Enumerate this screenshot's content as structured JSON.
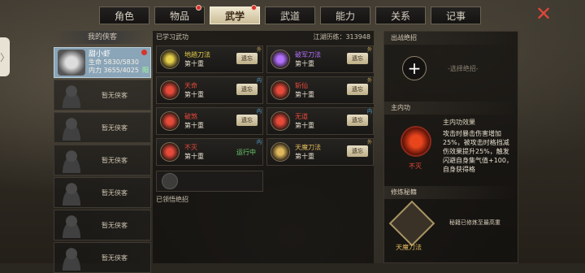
{
  "tabs": [
    {
      "label": "角色",
      "dot": false
    },
    {
      "label": "物品",
      "dot": true
    },
    {
      "label": "武学",
      "dot": true,
      "active": true
    },
    {
      "label": "武道",
      "dot": false
    },
    {
      "label": "能力",
      "dot": false
    },
    {
      "label": "关系",
      "dot": false
    },
    {
      "label": "记事",
      "dot": false
    }
  ],
  "left": {
    "title": "我的侠客",
    "hero": {
      "name": "甜小虾",
      "hp": "生命 5830/5830",
      "mp": "内力 3655/4025",
      "yang": "阳"
    },
    "empty_label": "暂无侠客"
  },
  "mid": {
    "learned_label": "已学习武功",
    "exp_label": "江湖历练：313948",
    "skills": [
      {
        "name": "地趟刀法",
        "level": "第十重",
        "button": "遗忘",
        "tag": "外",
        "color": "#e6d04a"
      },
      {
        "name": "破军刀法",
        "level": "第十重",
        "button": "遗忘",
        "tag": "外",
        "color": "#b470ff"
      },
      {
        "name": "天命",
        "level": "第十重",
        "button": "遗忘",
        "tag": "内",
        "color": "#e84a3a"
      },
      {
        "name": "斩仙",
        "level": "第十重",
        "button": "遗忘",
        "tag": "外",
        "color": "#e84a3a"
      },
      {
        "name": "破煞",
        "level": "第十重",
        "button": "遗忘",
        "tag": "内",
        "color": "#e84a3a"
      },
      {
        "name": "无道",
        "level": "第十重",
        "button": "遗忘",
        "tag": "内",
        "color": "#e84a3a"
      },
      {
        "name": "不灭",
        "level": "第十重",
        "status": "运行中",
        "tag": "内",
        "color": "#e84a3a"
      },
      {
        "name": "天魔刀法",
        "level": "第十重",
        "button": "遗忘",
        "tag": "外",
        "color": "#e0b85c"
      }
    ],
    "comprehended_label": "已领悟绝招"
  },
  "right": {
    "burst_label": "出战绝招",
    "choose_label": "-选择绝招-",
    "inner_label": "主内功",
    "inner_effect_title": "主内功效果",
    "inner_effect_desc": "攻击时暴击伤害增加25%，被攻击时格挡减伤效果提升25%，触发闪避自身集气值+100，自身获得格",
    "inner_name": "不灭",
    "cult_label": "修炼秘籍",
    "book_name": "天魔刀法",
    "cult_note": "秘籍已修炼至最高重"
  }
}
